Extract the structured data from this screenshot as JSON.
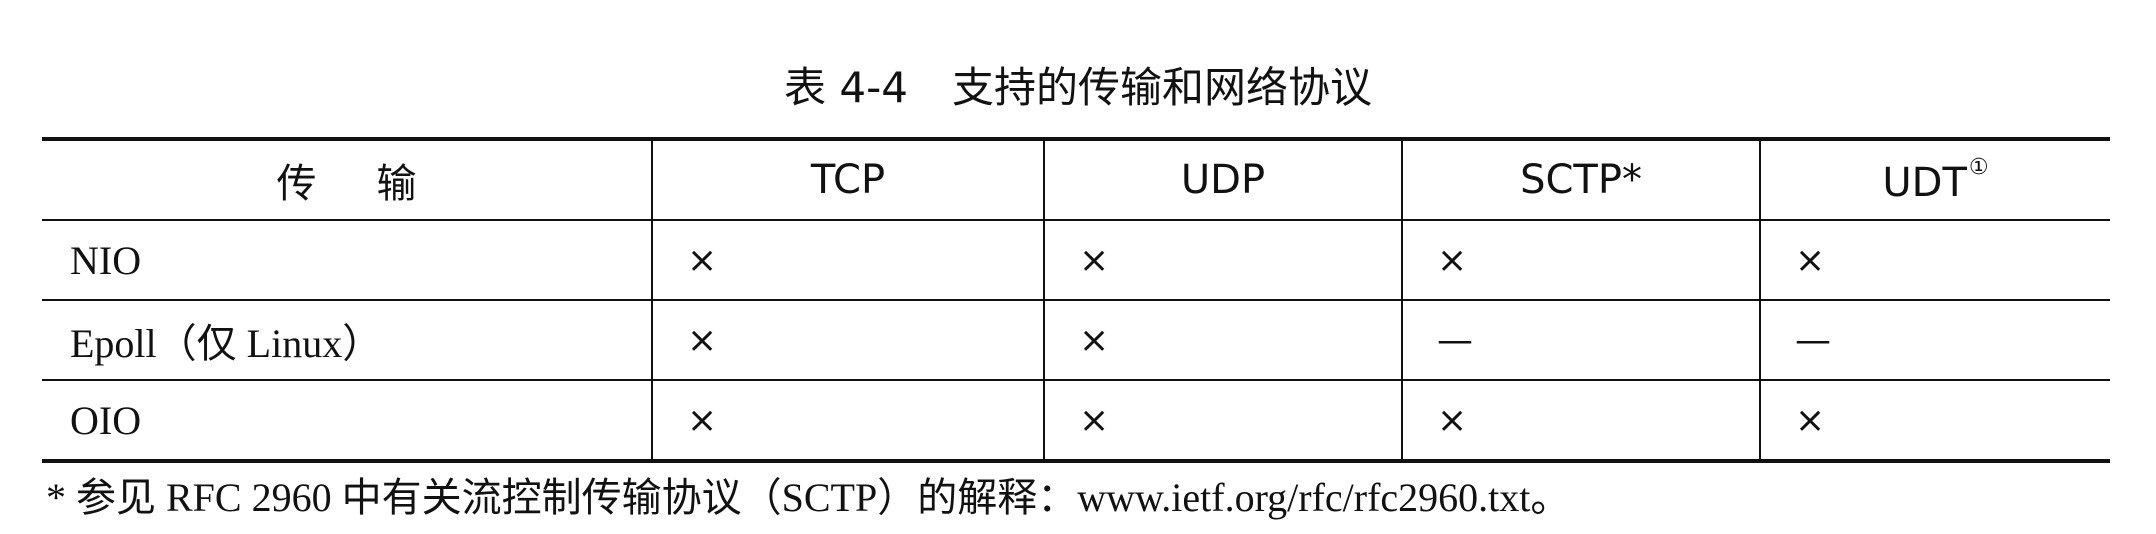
{
  "caption": {
    "number": "表 4-4",
    "title": "支持的传输和网络协议"
  },
  "table": {
    "columns": [
      {
        "label": "传输",
        "note": ""
      },
      {
        "label": "TCP",
        "note": ""
      },
      {
        "label": "UDP",
        "note": ""
      },
      {
        "label": "SCTP*",
        "note": ""
      },
      {
        "label": "UDT",
        "note": "①"
      }
    ],
    "rows": [
      {
        "transport": "NIO",
        "cells": [
          "×",
          "×",
          "×",
          "×"
        ]
      },
      {
        "transport": "Epoll（仅 Linux）",
        "cells": [
          "×",
          "×",
          "—",
          "—"
        ]
      },
      {
        "transport": "OIO",
        "cells": [
          "×",
          "×",
          "×",
          "×"
        ]
      }
    ]
  },
  "footnote": "* 参见 RFC 2960 中有关流控制传输协议（SCTP）的解释：www.ietf.org/rfc/rfc2960.txt。"
}
